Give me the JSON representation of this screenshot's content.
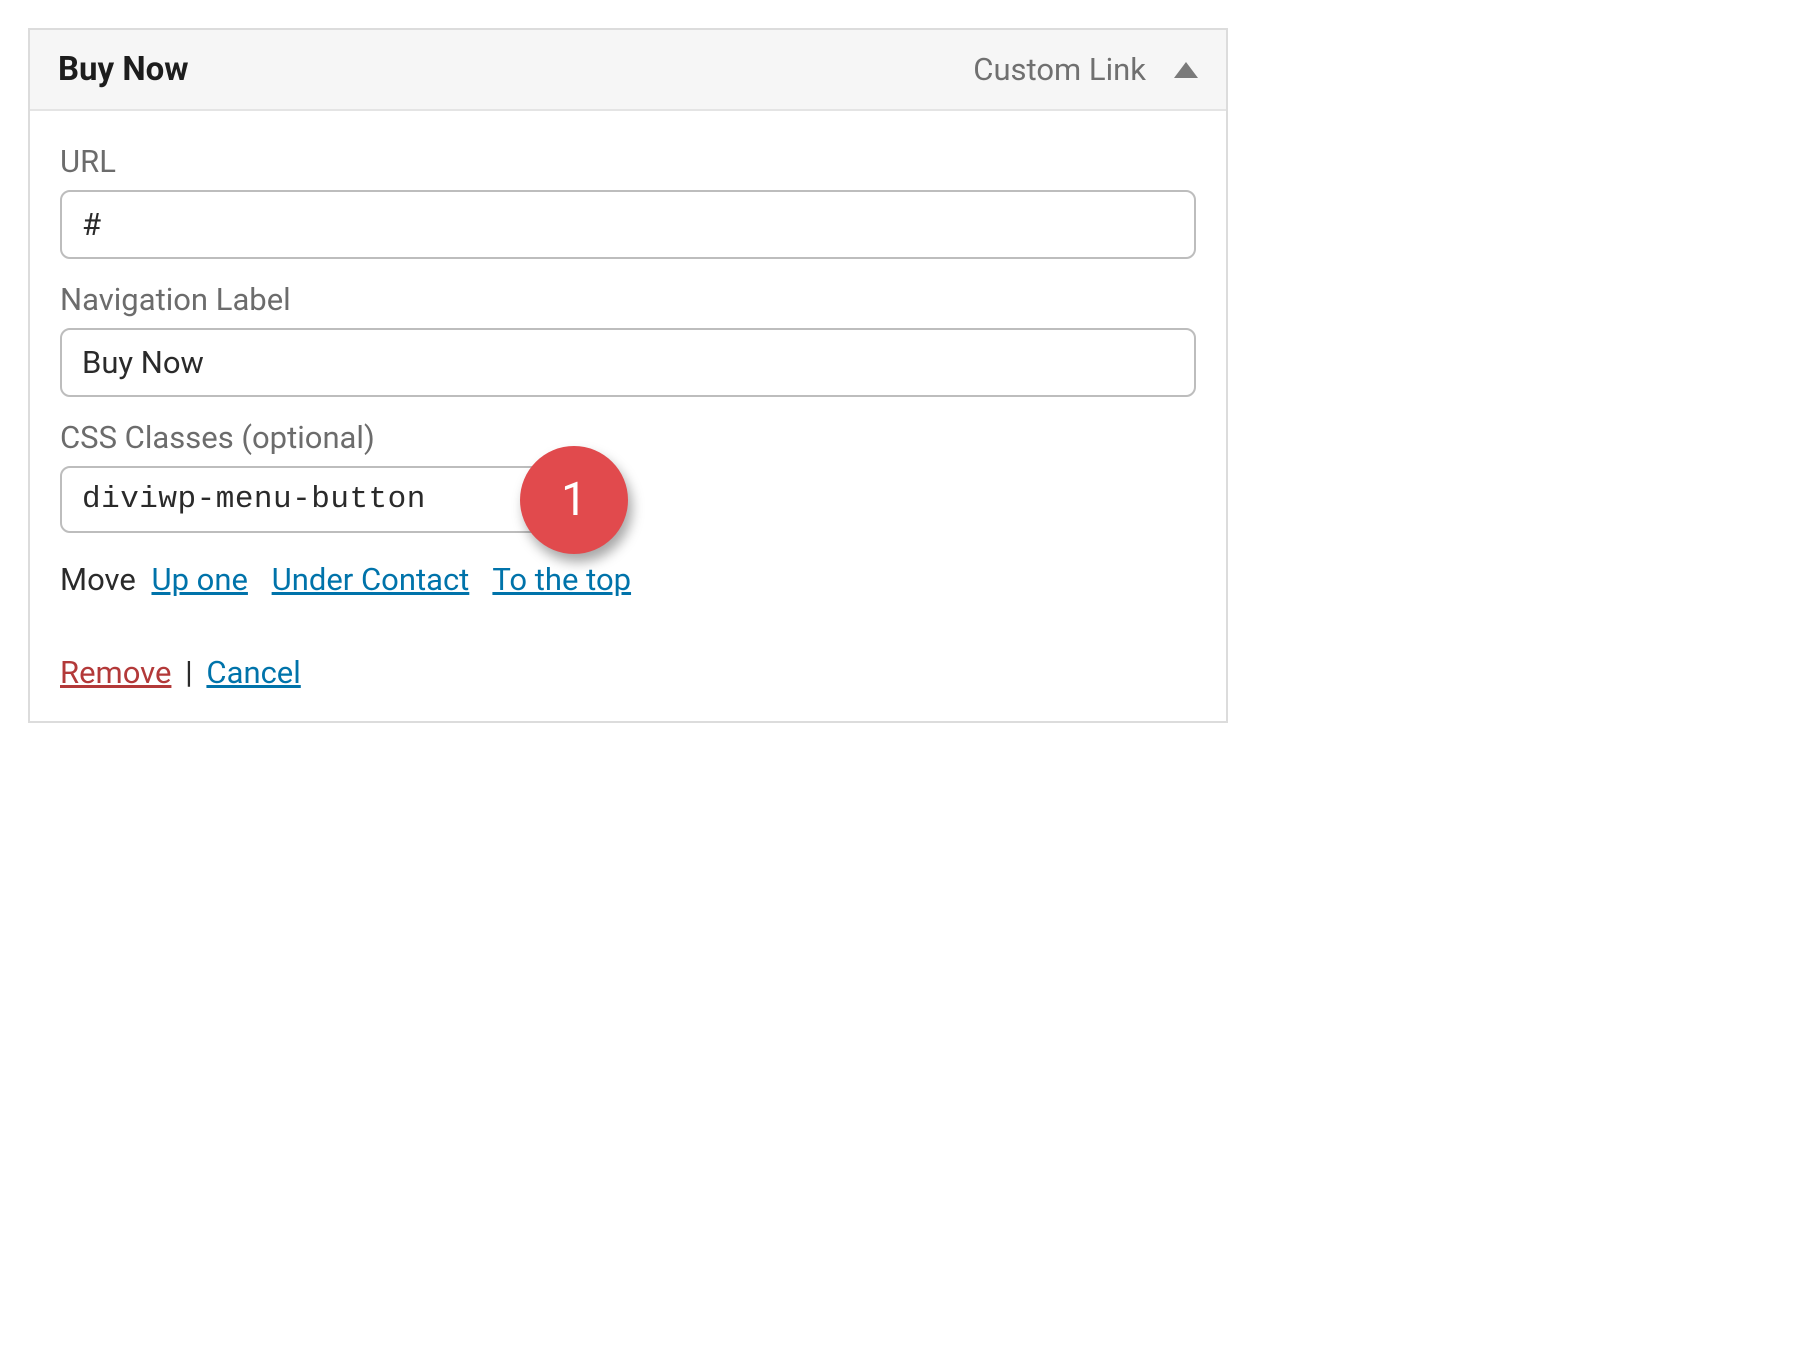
{
  "header": {
    "title": "Buy Now",
    "type": "Custom Link"
  },
  "fields": {
    "url": {
      "label": "URL",
      "value": "#"
    },
    "navLabel": {
      "label": "Navigation Label",
      "value": "Buy Now"
    },
    "cssClasses": {
      "label": "CSS Classes (optional)",
      "value": "diviwp-menu-button"
    }
  },
  "callout": {
    "number": "1"
  },
  "move": {
    "label": "Move",
    "upOne": "Up one",
    "underContact": "Under Contact",
    "toTheTop": "To the top"
  },
  "actions": {
    "remove": "Remove",
    "separator": "|",
    "cancel": "Cancel"
  }
}
